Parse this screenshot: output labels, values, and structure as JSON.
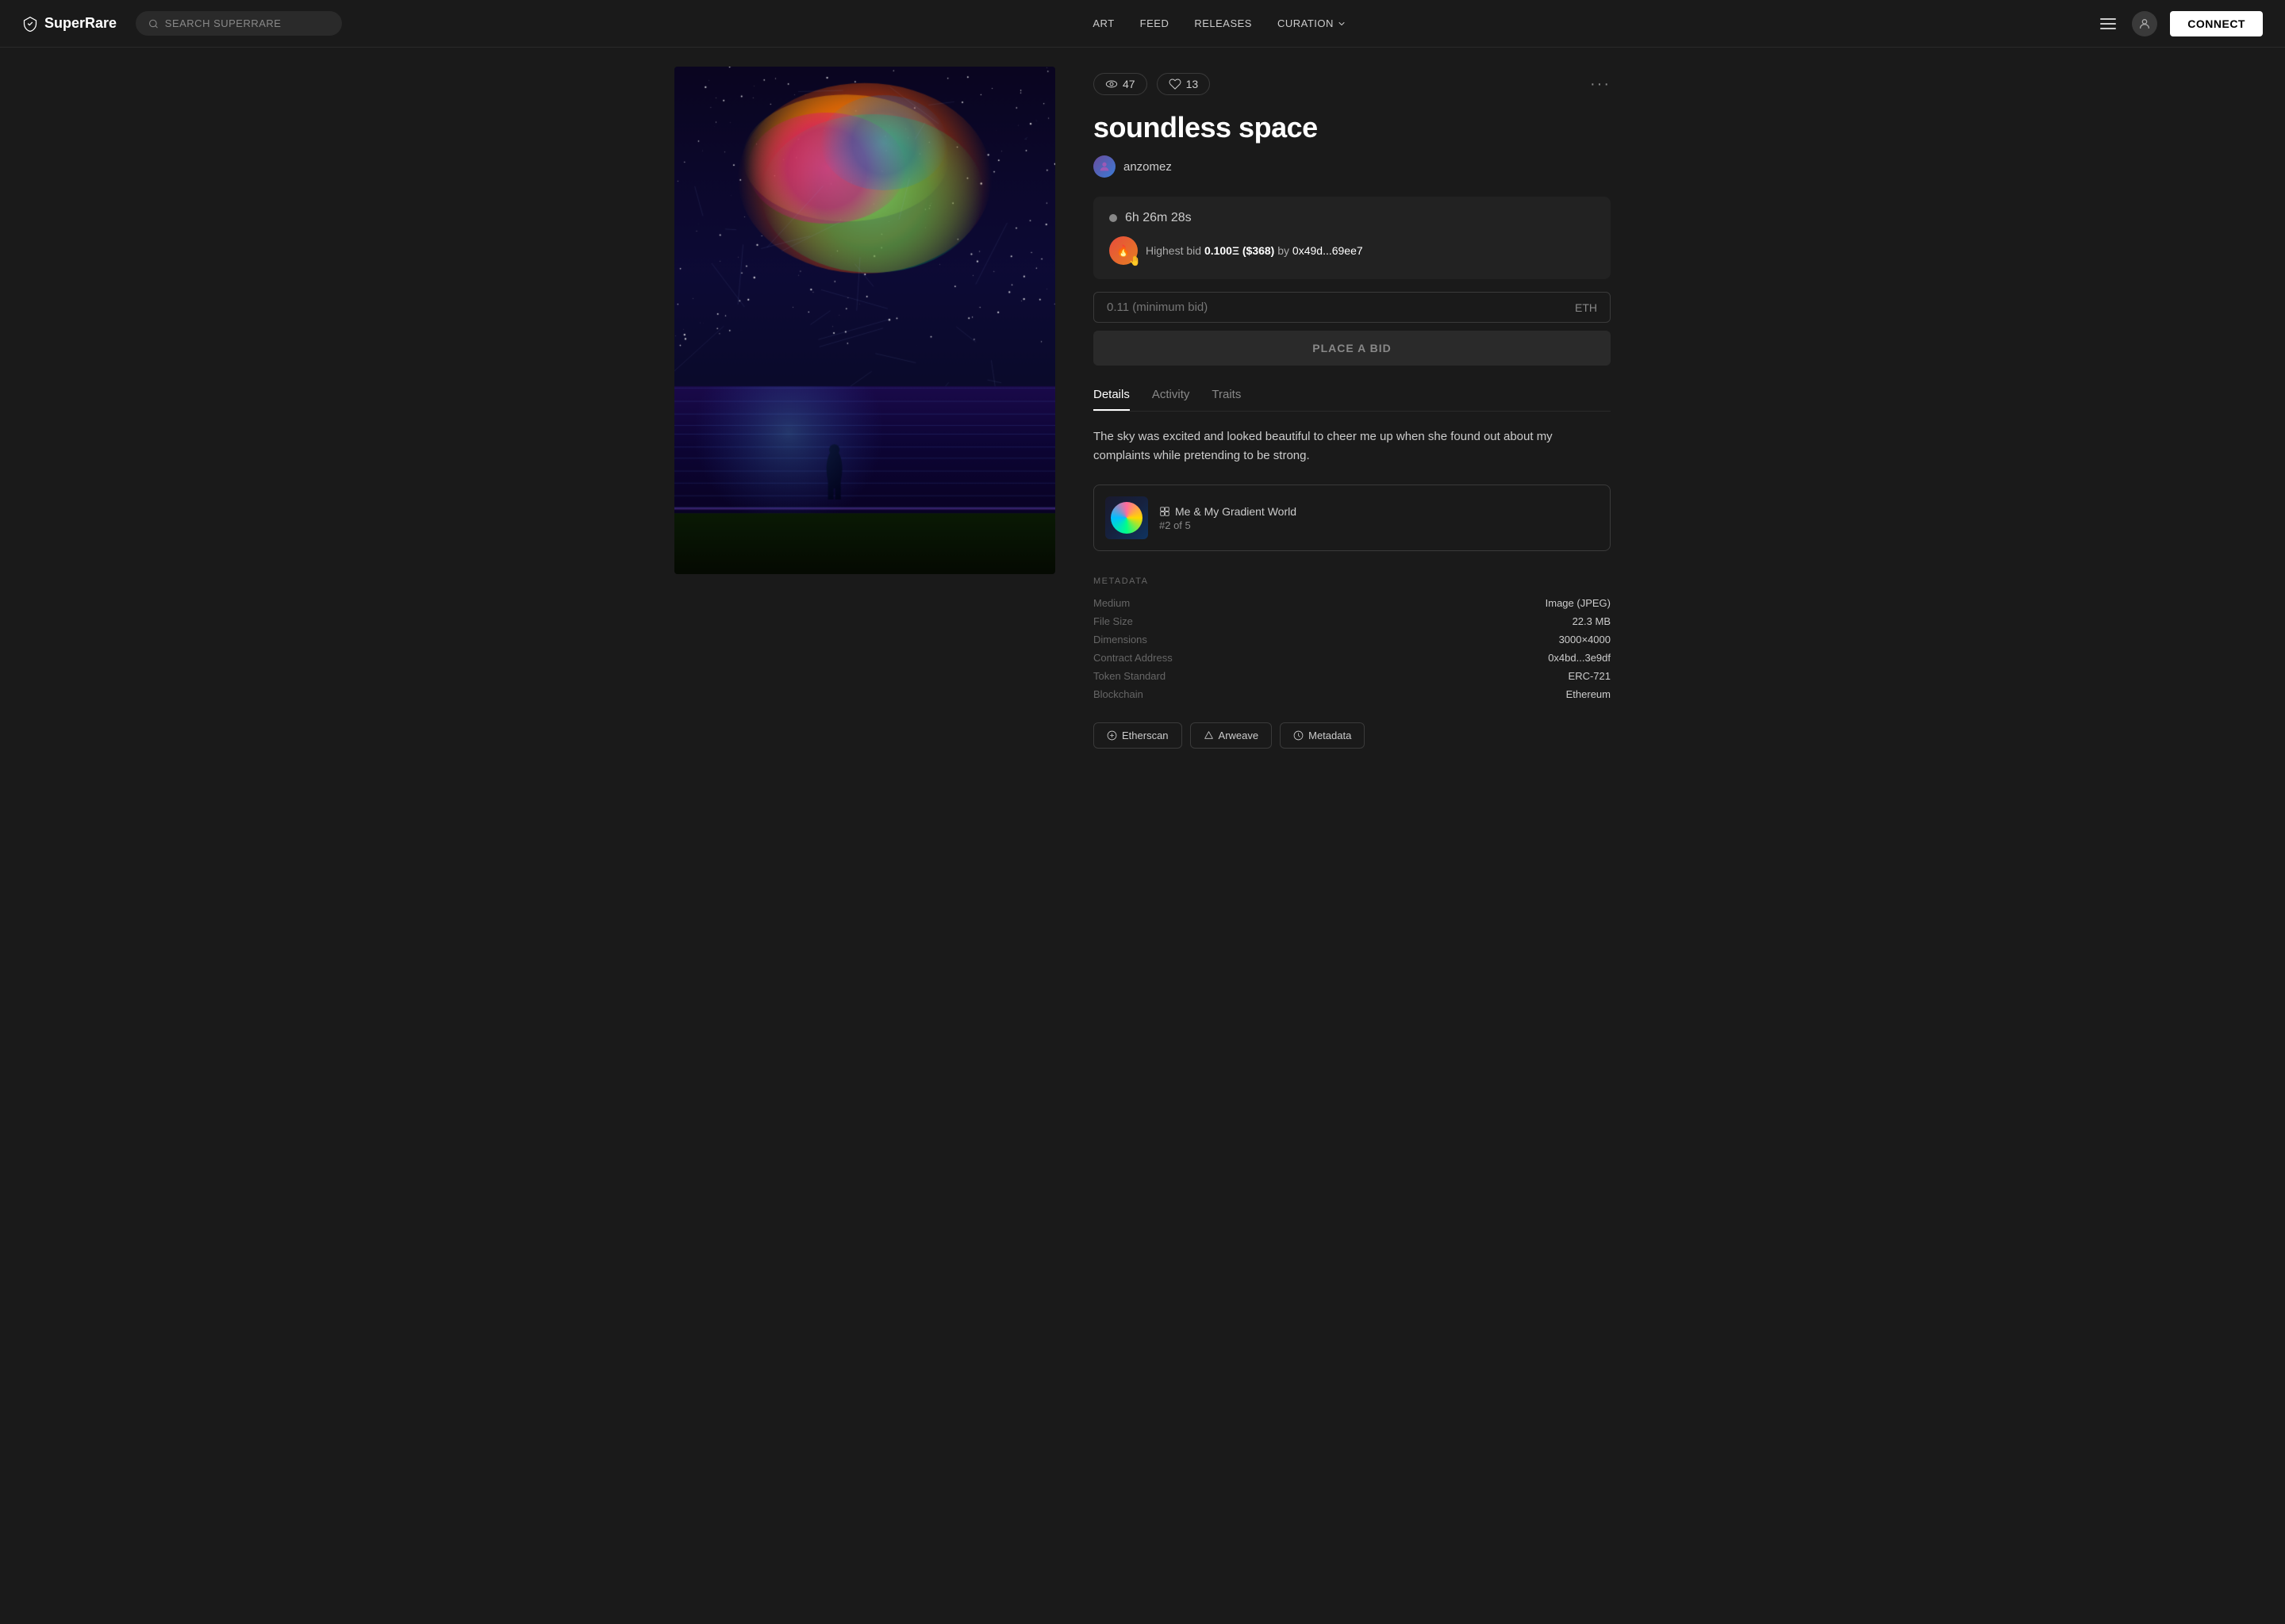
{
  "header": {
    "logo_text": "SuperRare",
    "search_placeholder": "SEARCH SUPERRARE",
    "nav": [
      {
        "label": "ART",
        "id": "art"
      },
      {
        "label": "FEED",
        "id": "feed"
      },
      {
        "label": "RELEASES",
        "id": "releases"
      },
      {
        "label": "CURATION",
        "id": "curation",
        "has_dropdown": true
      }
    ],
    "connect_label": "CONNECT"
  },
  "artwork": {
    "title": "soundless space",
    "artist": "anzomez",
    "views": "47",
    "likes": "13",
    "timer": "6h 26m 28s",
    "highest_bid": "0.100Ξ ($368)",
    "bidder_address": "0x49d...69ee7",
    "min_bid_placeholder": "0.11 (minimum bid)",
    "eth_label": "ETH",
    "place_bid_label": "PLACE A BID"
  },
  "tabs": [
    {
      "label": "Details",
      "id": "details",
      "active": true
    },
    {
      "label": "Activity",
      "id": "activity",
      "active": false
    },
    {
      "label": "Traits",
      "id": "traits",
      "active": false
    }
  ],
  "details": {
    "description": "The sky was excited and looked beautiful to cheer me up when she found out about my complaints while pretending to be strong.",
    "collection_name": "Me & My Gradient World",
    "collection_number": "#2 of 5",
    "metadata_label": "METADATA",
    "meta_fields": [
      {
        "label": "Medium",
        "value": "Image (JPEG)"
      },
      {
        "label": "File Size",
        "value": "22.3 MB"
      },
      {
        "label": "Dimensions",
        "value": "3000×4000"
      },
      {
        "label": "Contract Address",
        "value": "0x4bd...3e9df"
      },
      {
        "label": "Token Standard",
        "value": "ERC-721"
      },
      {
        "label": "Blockchain",
        "value": "Ethereum"
      }
    ],
    "external_links": [
      {
        "label": "Etherscan",
        "icon": "etherscan-icon"
      },
      {
        "label": "Arweave",
        "icon": "arweave-icon"
      },
      {
        "label": "Metadata",
        "icon": "metadata-icon"
      }
    ]
  },
  "colors": {
    "bg": "#1a1a1a",
    "surface": "#222222",
    "border": "#3a3a3a",
    "accent": "#ffffff",
    "muted": "#888888"
  }
}
